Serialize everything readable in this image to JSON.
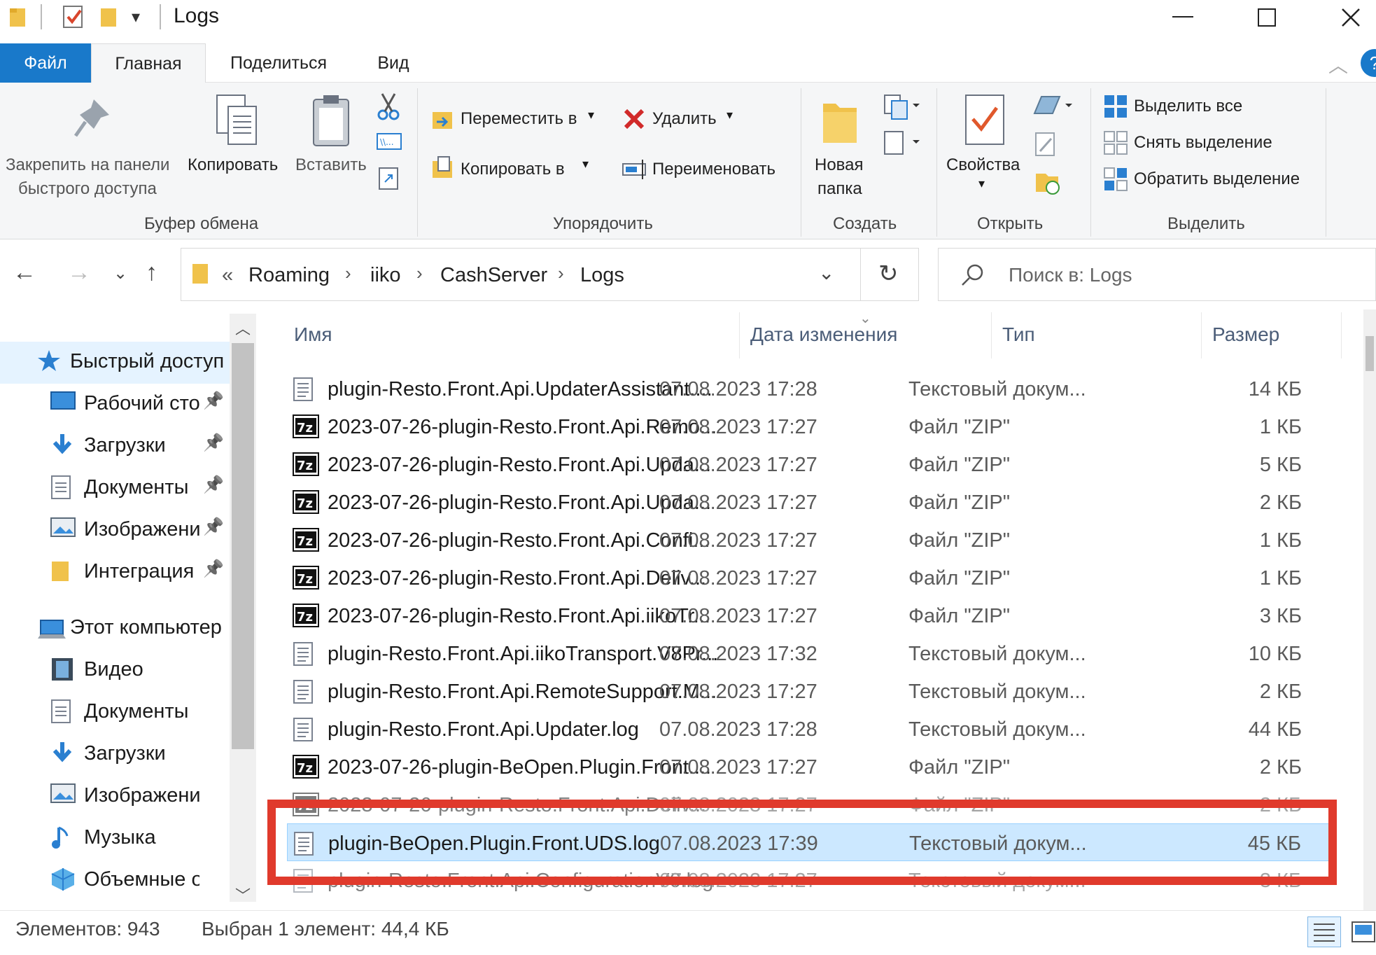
{
  "window": {
    "title": "Logs",
    "controls": [
      "minimize",
      "maximize",
      "close"
    ]
  },
  "ribbon": {
    "tabs": [
      "Файл",
      "Главная",
      "Поделиться",
      "Вид"
    ],
    "active_tab": "Главная",
    "clipboard": {
      "pin_label_1": "Закрепить на панели",
      "pin_label_2": "быстрого доступа",
      "copy_label": "Копировать",
      "paste_label": "Вставить",
      "group_label": "Буфер обмена"
    },
    "organize": {
      "move_to": "Переместить в",
      "copy_to": "Копировать в",
      "delete": "Удалить",
      "rename": "Переименовать",
      "group_label": "Упорядочить"
    },
    "new": {
      "new_folder_1": "Новая",
      "new_folder_2": "папка",
      "group_label": "Создать"
    },
    "open": {
      "properties": "Свойства",
      "group_label": "Открыть"
    },
    "select": {
      "select_all": "Выделить все",
      "select_none": "Снять выделение",
      "invert": "Обратить выделение",
      "group_label": "Выделить"
    }
  },
  "address": {
    "overflow": "«",
    "breadcrumbs": [
      "Roaming",
      "iiko",
      "CashServer",
      "Logs"
    ],
    "search_placeholder": "Поиск в: Logs"
  },
  "navpane": {
    "quick_access": "Быстрый доступ",
    "pinned": [
      "Рабочий стол",
      "Загрузки",
      "Документы",
      "Изображения",
      "Интеграция"
    ],
    "this_pc": "Этот компьютер",
    "pc_items": [
      "Видео",
      "Документы",
      "Загрузки",
      "Изображения",
      "Музыка",
      "Объемные объекты"
    ]
  },
  "columns": {
    "name": "Имя",
    "date": "Дата изменения",
    "type": "Тип",
    "size": "Размер"
  },
  "files": [
    {
      "name": "plugin-Resto.Front.Api.UpdaterAssistant....",
      "date": "07.08.2023 17:28",
      "type": "Текстовый докум...",
      "size": "14 КБ",
      "icon": "text-file-icon"
    },
    {
      "name": "2023-07-26-plugin-Resto.Front.Api.Remo...",
      "date": "07.08.2023 17:27",
      "type": "Файл \"ZIP\"",
      "size": "1 КБ",
      "icon": "7z-archive-icon"
    },
    {
      "name": "2023-07-26-plugin-Resto.Front.Api.Upda...",
      "date": "07.08.2023 17:27",
      "type": "Файл \"ZIP\"",
      "size": "5 КБ",
      "icon": "7z-archive-icon"
    },
    {
      "name": "2023-07-26-plugin-Resto.Front.Api.Upda...",
      "date": "07.08.2023 17:27",
      "type": "Файл \"ZIP\"",
      "size": "2 КБ",
      "icon": "7z-archive-icon"
    },
    {
      "name": "2023-07-26-plugin-Resto.Front.Api.Confi...",
      "date": "07.08.2023 17:27",
      "type": "Файл \"ZIP\"",
      "size": "1 КБ",
      "icon": "7z-archive-icon"
    },
    {
      "name": "2023-07-26-plugin-Resto.Front.Api.Deliv...",
      "date": "07.08.2023 17:27",
      "type": "Файл \"ZIP\"",
      "size": "1 КБ",
      "icon": "7z-archive-icon"
    },
    {
      "name": "2023-07-26-plugin-Resto.Front.Api.iikoTr...",
      "date": "07.08.2023 17:27",
      "type": "Файл \"ZIP\"",
      "size": "3 КБ",
      "icon": "7z-archive-icon"
    },
    {
      "name": "plugin-Resto.Front.Api.iikoTransport.V8Pr...",
      "date": "07.08.2023 17:32",
      "type": "Текстовый докум...",
      "size": "10 КБ",
      "icon": "text-file-icon"
    },
    {
      "name": "plugin-Resto.Front.Api.RemoteSupport.M...",
      "date": "07.08.2023 17:27",
      "type": "Текстовый докум...",
      "size": "2 КБ",
      "icon": "text-file-icon"
    },
    {
      "name": "plugin-Resto.Front.Api.Updater.log",
      "date": "07.08.2023 17:28",
      "type": "Текстовый докум...",
      "size": "44 КБ",
      "icon": "text-file-icon"
    },
    {
      "name": "2023-07-26-plugin-BeOpen.Plugin.Front....",
      "date": "07.08.2023 17:27",
      "type": "Файл \"ZIP\"",
      "size": "2 КБ",
      "icon": "7z-archive-icon"
    },
    {
      "name": "2023-07-26-plugin-Resto.Front.Api.Deliv...",
      "date": "07.08.2023 17:27",
      "type": "Файл \"ZIP\"",
      "size": "2 КБ",
      "icon": "7z-archive-icon",
      "partial": true
    },
    {
      "name": "plugin-BeOpen.Plugin.Front.UDS.log",
      "date": "07.08.2023 17:39",
      "type": "Текстовый докум...",
      "size": "45 КБ",
      "icon": "text-file-icon",
      "selected": true
    },
    {
      "name": "plugin-Resto.Front.Api.ConfigurationV6.log",
      "date": "07.08.2023 17:27",
      "type": "Текстовый докум...",
      "size": "3 КБ",
      "icon": "text-file-icon",
      "partial": true
    }
  ],
  "status": {
    "count": "Элементов: 943",
    "selection": "Выбран 1 элемент: 44,4 КБ"
  },
  "colors": {
    "file_tab": "#1979ca",
    "selection": "#cce8ff",
    "highlight": "#e03a2c"
  }
}
